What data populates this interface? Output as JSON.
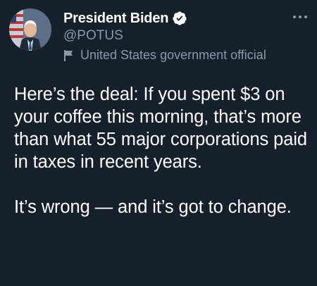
{
  "author": {
    "display_name": "President Biden",
    "handle": "@POTUS",
    "label": "United States government official",
    "icons": {
      "verified": "verified-badge-icon",
      "label": "flag-icon",
      "more": "more-options-icon"
    }
  },
  "tweet": {
    "paragraph_1": "Here’s the deal: If you spent $3 on your coffee this morning, that’s more than what 55 major corporations paid in taxes in recent years.",
    "paragraph_2": "It’s wrong — and it’s got to change."
  },
  "colors": {
    "background": "#15202b",
    "text_primary": "#ffffff",
    "text_secondary": "#8b98a5"
  }
}
